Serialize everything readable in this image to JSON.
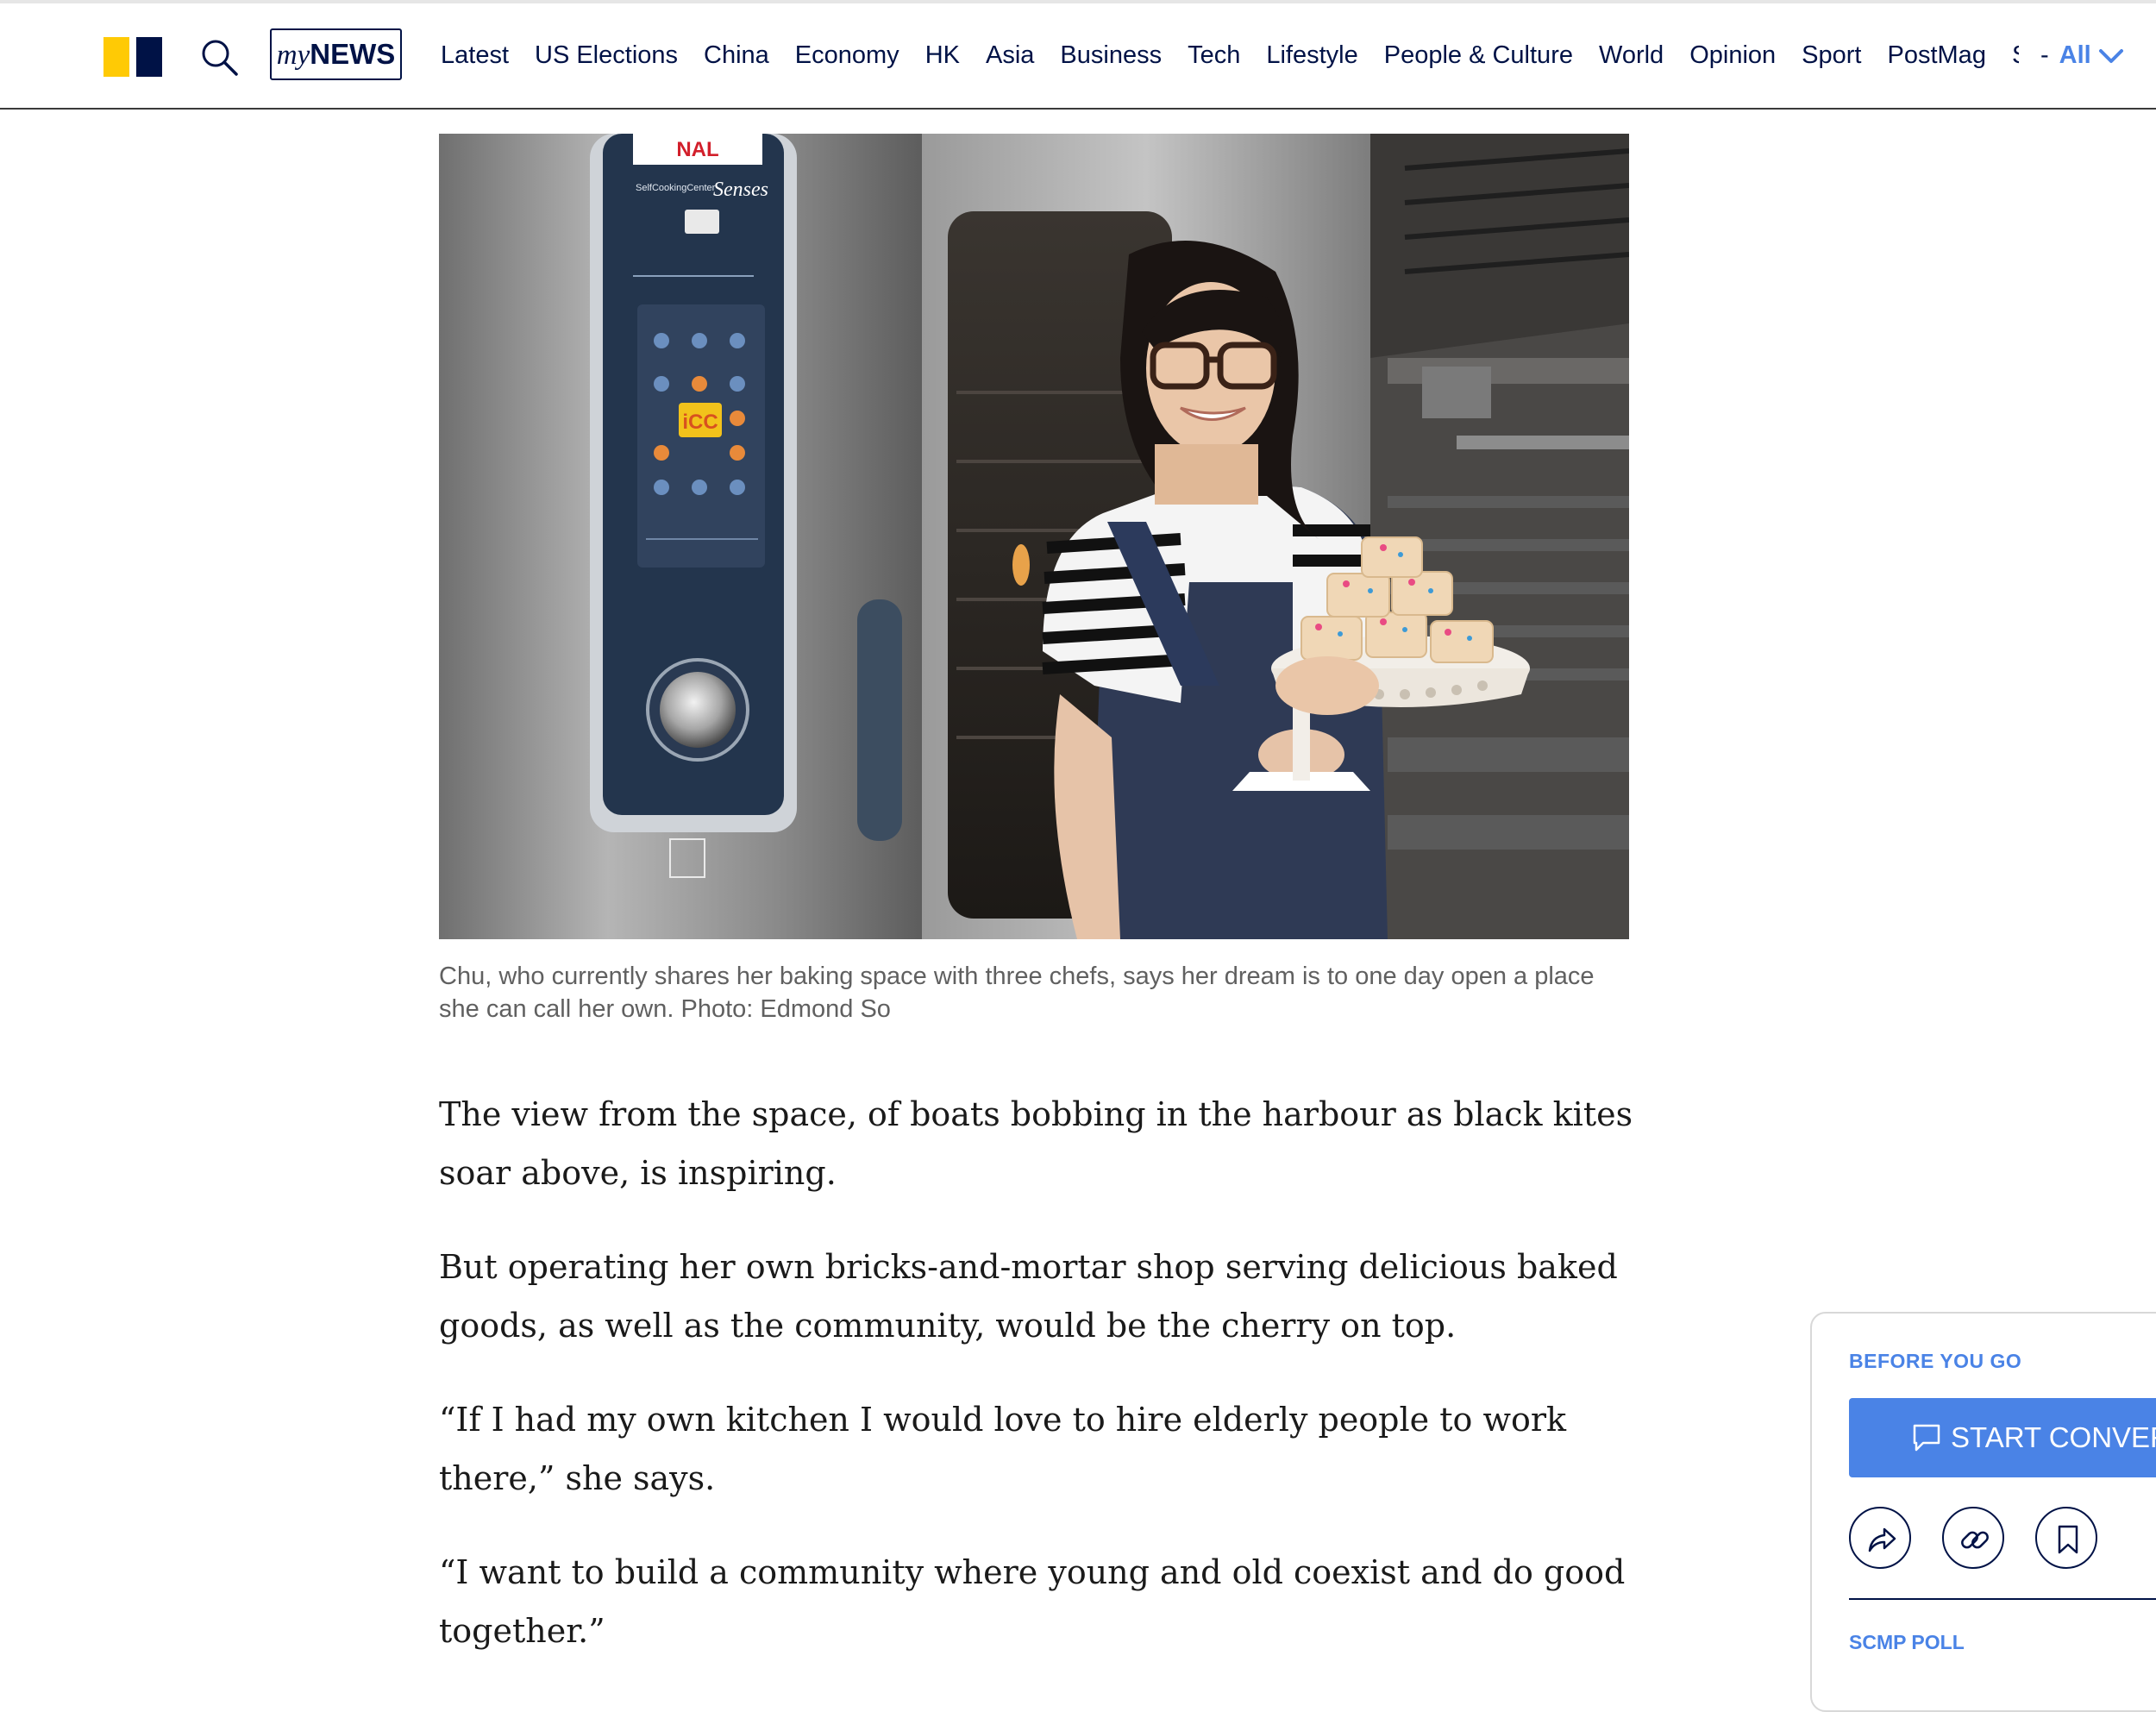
{
  "header": {
    "mynews_prefix": "my",
    "mynews_suffix": "NEWS",
    "nav": [
      "Latest",
      "US Elections",
      "China",
      "Economy",
      "HK",
      "Asia",
      "Business",
      "Tech",
      "Lifestyle",
      "People & Culture",
      "World",
      "Opinion",
      "Sport",
      "PostMag",
      "S"
    ],
    "all_separator": "-",
    "all_label": "All"
  },
  "photo": {
    "oven_brand": "SelfCookingCenter",
    "oven_model": "Senses",
    "screen_logo": "iCC"
  },
  "caption": "Chu, who currently shares her baking space with three chefs, says her dream is to one day open a place she can call her own. Photo: Edmond So",
  "article": {
    "paragraphs": [
      "The view from the space, of boats bobbing in the harbour as black kites soar above, is inspiring.",
      "But operating her own bricks-and-mortar shop serving delicious baked goods, as well as the community, would be the cherry on top.",
      "“If I had my own kitchen I would love to hire elderly people to work there,” she says.",
      "“I want to build a community where young and old coexist and do good together.”"
    ]
  },
  "sidebar": {
    "title": "BEFORE YOU GO",
    "button_label": "START CONVERSATION",
    "poll_title": "SCMP POLL"
  },
  "colors": {
    "navy": "#001246",
    "accent_blue": "#4a83e6",
    "logo_yellow": "#ffca05"
  }
}
